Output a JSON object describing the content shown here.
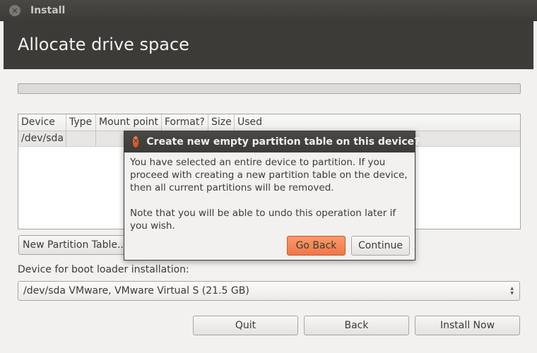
{
  "window": {
    "title": "Install"
  },
  "header": {
    "title": "Allocate drive space"
  },
  "table": {
    "columns": [
      "Device",
      "Type",
      "Mount point",
      "Format?",
      "Size",
      "Used"
    ],
    "rows": [
      [
        "/dev/sda",
        "",
        "",
        "",
        "",
        ""
      ]
    ]
  },
  "actions": {
    "new_partition_table": "New Partition Table..."
  },
  "bootloader": {
    "label": "Device for boot loader installation:",
    "selected": "/dev/sda VMware, VMware Virtual S (21.5 GB)"
  },
  "footer": {
    "quit": "Quit",
    "back": "Back",
    "install_now": "Install Now"
  },
  "dialog": {
    "title": "Create new empty partition table on this device?",
    "message_1": "You have selected an entire device to partition. If you proceed with creating a new partition table on the device, then all current partitions will be removed.",
    "message_2": "Note that you will be able to undo this operation later if you wish.",
    "go_back": "Go Back",
    "continue": "Continue"
  },
  "colors": {
    "accent": "#f07746",
    "header_bg": "#3c3b37",
    "window_bg": "#f2f1f0"
  }
}
